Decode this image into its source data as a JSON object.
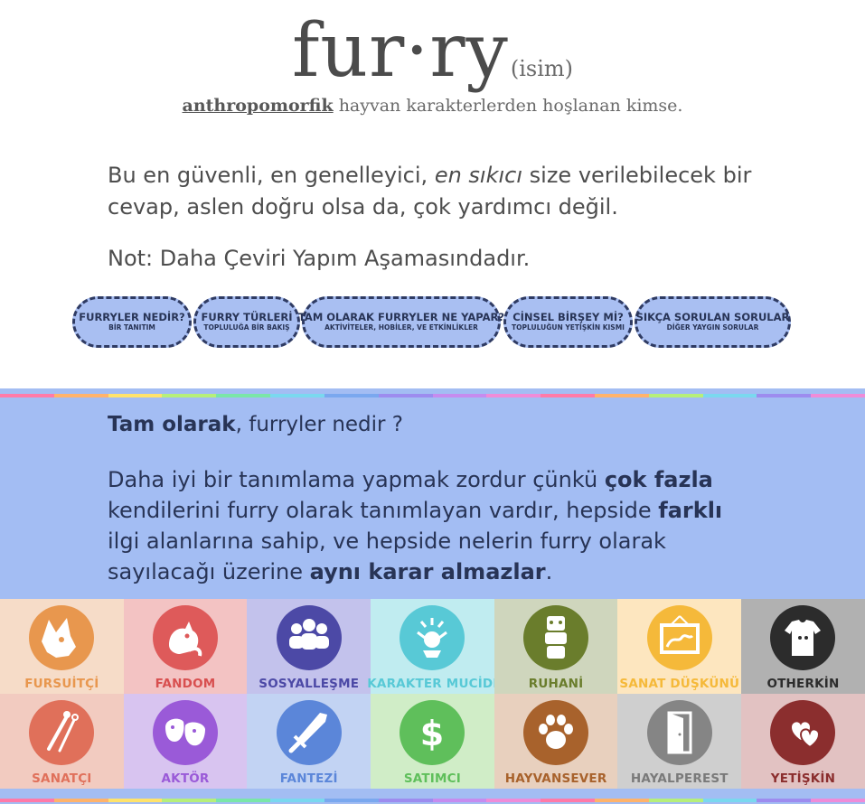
{
  "header": {
    "word": "fur·ry",
    "part_of_speech": "(isim)",
    "definition_term": "anthropomorfik",
    "definition_rest": " hayvan karakterlerden hoşlanan kimse."
  },
  "intro": {
    "line_a": "Bu en güvenli, en genelleyici, ",
    "emph": "en sıkıcı",
    "line_b": " size verilebilecek bir cevap, aslen doğru olsa da, çok yardımcı değil.",
    "note": "Not: Daha Çeviri Yapım Aşamasındadır."
  },
  "nav": [
    {
      "label": "FURRYLER NEDİR?",
      "sub": "BİR TANITIM"
    },
    {
      "label": "FURRY TÜRLERİ",
      "sub": "TOPLULUĞA BİR BAKIŞ"
    },
    {
      "label": "TAM OLARAK FURRYLER NE YAPAR?",
      "sub": "AKTİVİTELER, HOBİLER, VE ETKİNLİKLER"
    },
    {
      "label": "CİNSEL BİRŞEY Mİ?",
      "sub": "TOPLULUĞUN YETİŞKİN KISMI"
    },
    {
      "label": "SIKÇA SORULAN SORULAR",
      "sub": "DİĞER YAYGIN SORULAR"
    }
  ],
  "section": {
    "q_bold": "Tam olarak",
    "q_rest": ", furryler nedir ?",
    "p1": "Daha iyi bir tanımlama yapmak zordur çünkü ",
    "p1_b": "çok fazla",
    "p2": " kendilerini furry olarak tanımlayan vardır, hepside ",
    "p2_b": "farklı",
    "p3": " ilgi alanlarına sahip, ve hepside nelerin furry olarak sayılacağı üzerine ",
    "p3_b": "aynı karar almazlar",
    "p4": "."
  },
  "categories": [
    {
      "label": "FURSUİTÇİ",
      "icon": "fursuit-head-icon",
      "bg": "#f6dcc8",
      "circle": "#e8974e",
      "text": "#e8974e"
    },
    {
      "label": "FANDOM",
      "icon": "fox-couple-icon",
      "bg": "#f3c3c3",
      "circle": "#de5a5a",
      "text": "#d84f4f"
    },
    {
      "label": "SOSYALLEŞME",
      "icon": "group-people-icon",
      "bg": "#c3c2ec",
      "circle": "#4c49a6",
      "text": "#4c49a6"
    },
    {
      "label": "KARAKTER MUCİDİ",
      "icon": "creator-sparkle-icon",
      "bg": "#c0ecf0",
      "circle": "#58c9d6",
      "text": "#58c9d6"
    },
    {
      "label": "RUHANİ",
      "icon": "totem-icon",
      "bg": "#cfd6bd",
      "circle": "#6a7d2c",
      "text": "#6a7d2c"
    },
    {
      "label": "SANAT DÜŞKÜNÜ",
      "icon": "framed-art-icon",
      "bg": "#fde6bf",
      "circle": "#f5b93a",
      "text": "#f5b93a"
    },
    {
      "label": "OTHERKİN",
      "icon": "tshirt-icon",
      "bg": "#b1b1b1",
      "circle": "#2c2c2c",
      "text": "#2c2c2c"
    },
    {
      "label": "SANATÇI",
      "icon": "paintbrush-icon",
      "bg": "#f2cbc0",
      "circle": "#e0705a",
      "text": "#e0705a"
    },
    {
      "label": "AKTÖR",
      "icon": "masks-icon",
      "bg": "#d8c4f0",
      "circle": "#9a5ad8",
      "text": "#9a5ad8"
    },
    {
      "label": "FANTEZİ",
      "icon": "sword-icon",
      "bg": "#c2d3f3",
      "circle": "#5b86d9",
      "text": "#5b86d9"
    },
    {
      "label": "SATIMCI",
      "icon": "dollar-icon",
      "bg": "#d0edc7",
      "circle": "#5fbf5b",
      "text": "#5fbf5b"
    },
    {
      "label": "HAYVANSEVER",
      "icon": "paw-icon",
      "bg": "#e8d0be",
      "circle": "#a8622c",
      "text": "#a8622c"
    },
    {
      "label": "HAYALPEREST",
      "icon": "door-icon",
      "bg": "#cfcfcf",
      "circle": "#858585",
      "text": "#7a7a7a"
    },
    {
      "label": "YETİŞKİN",
      "icon": "hearts-icon",
      "bg": "#e2c2c2",
      "circle": "#8b2e2e",
      "text": "#8b2e2e"
    }
  ],
  "rainbow": [
    "#ff7aa8",
    "#ffb36b",
    "#ffe36b",
    "#b6ef7a",
    "#7ae6a8",
    "#7ad8ef",
    "#7aa8ef",
    "#9d8cef",
    "#c68cef",
    "#ef8cd8",
    "#ff7aa8",
    "#ffb36b",
    "#b6ef7a",
    "#7ad8ef",
    "#9d8cef",
    "#ef8cd8"
  ]
}
